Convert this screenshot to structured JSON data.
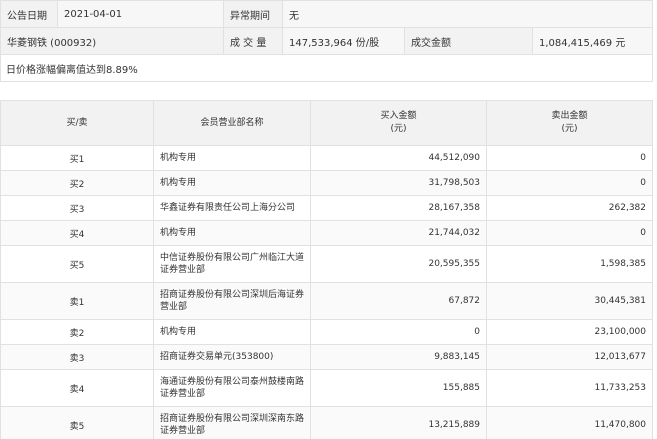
{
  "info": {
    "date_label": "公告日期",
    "date_value": "2021-04-01",
    "period_label": "异常期间",
    "period_value": "无",
    "stock": "华菱钢铁 (000932)",
    "volume_label": "成 交 量",
    "volume_value": "147,533,964 份/股",
    "amount_label": "成交金额",
    "amount_value": "1,084,415,469 元",
    "note": "日价格涨幅偏离值达到8.89%"
  },
  "table": {
    "headers": {
      "direction": "买/卖",
      "member": "会员营业部名称",
      "buy": "买入金额",
      "buy_unit": "(元)",
      "sell": "卖出金额",
      "sell_unit": "(元)"
    },
    "rows": [
      {
        "dir": "买1",
        "name": "机构专用",
        "buy": "44,512,090",
        "sell": "0"
      },
      {
        "dir": "买2",
        "name": "机构专用",
        "buy": "31,798,503",
        "sell": "0"
      },
      {
        "dir": "买3",
        "name": "华鑫证券有限责任公司上海分公司",
        "buy": "28,167,358",
        "sell": "262,382"
      },
      {
        "dir": "买4",
        "name": "机构专用",
        "buy": "21,744,032",
        "sell": "0"
      },
      {
        "dir": "买5",
        "name": "中信证券股份有限公司广州临江大道证券营业部",
        "buy": "20,595,355",
        "sell": "1,598,385"
      },
      {
        "dir": "卖1",
        "name": "招商证券股份有限公司深圳后海证券营业部",
        "buy": "67,872",
        "sell": "30,445,381"
      },
      {
        "dir": "卖2",
        "name": "机构专用",
        "buy": "0",
        "sell": "23,100,000"
      },
      {
        "dir": "卖3",
        "name": "招商证券交易单元(353800)",
        "buy": "9,883,145",
        "sell": "12,013,677"
      },
      {
        "dir": "卖4",
        "name": "海通证券股份有限公司泰州鼓楼南路证券营业部",
        "buy": "155,885",
        "sell": "11,733,253"
      },
      {
        "dir": "卖5",
        "name": "招商证券股份有限公司深圳深南东路证券营业部",
        "buy": "13,215,889",
        "sell": "11,470,800"
      }
    ]
  }
}
